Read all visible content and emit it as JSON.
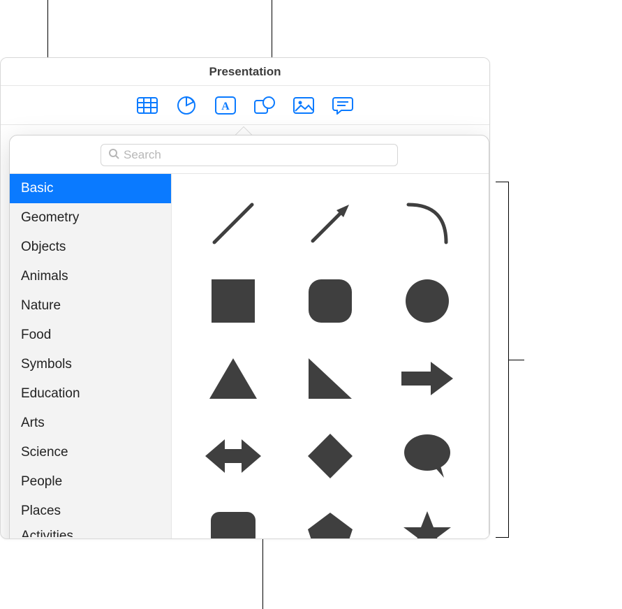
{
  "window": {
    "title": "Presentation"
  },
  "toolbar": {
    "items": [
      {
        "name": "table-button"
      },
      {
        "name": "chart-button"
      },
      {
        "name": "text-button"
      },
      {
        "name": "shape-button"
      },
      {
        "name": "media-button"
      },
      {
        "name": "comment-button"
      }
    ],
    "accent": "#0a7aff"
  },
  "search": {
    "placeholder": "Search"
  },
  "sidebar": {
    "selected_index": 0,
    "items": [
      {
        "label": "Basic"
      },
      {
        "label": "Geometry"
      },
      {
        "label": "Objects"
      },
      {
        "label": "Animals"
      },
      {
        "label": "Nature"
      },
      {
        "label": "Food"
      },
      {
        "label": "Symbols"
      },
      {
        "label": "Education"
      },
      {
        "label": "Arts"
      },
      {
        "label": "Science"
      },
      {
        "label": "People"
      },
      {
        "label": "Places"
      },
      {
        "label": "Activities"
      }
    ]
  },
  "shapes": {
    "items": [
      {
        "name": "line-shape"
      },
      {
        "name": "arrow-line-shape"
      },
      {
        "name": "curve-shape"
      },
      {
        "name": "square-shape"
      },
      {
        "name": "rounded-square-shape"
      },
      {
        "name": "circle-shape"
      },
      {
        "name": "triangle-shape"
      },
      {
        "name": "right-triangle-shape"
      },
      {
        "name": "arrow-right-shape"
      },
      {
        "name": "double-arrow-shape"
      },
      {
        "name": "diamond-shape"
      },
      {
        "name": "speech-bubble-round-shape"
      },
      {
        "name": "speech-bubble-square-shape"
      },
      {
        "name": "pentagon-shape"
      },
      {
        "name": "star-shape"
      }
    ],
    "fill": "#3f3f3f"
  }
}
